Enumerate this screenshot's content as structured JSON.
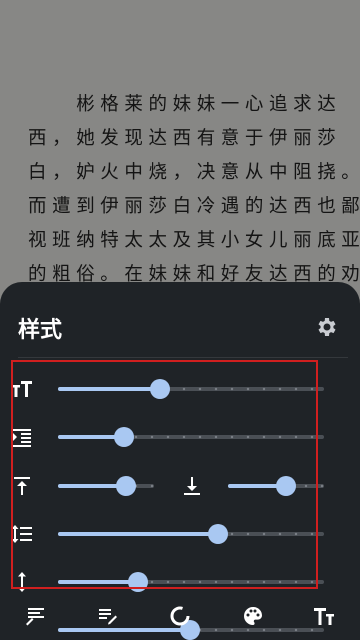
{
  "reader": {
    "lines": [
      "　　彬格莱的妹妹一心追求达",
      "西，她发现达西有意于伊丽莎",
      "白，妒火中烧，决意从中阻挠。",
      "而遭到伊丽莎白冷遇的达西也鄙",
      "视班纳特太太及其小女儿丽底亚",
      "的粗俗。在妹妹和好友达西的劝"
    ]
  },
  "style_panel": {
    "title": "样式",
    "sliders": [
      {
        "icon": "text-size-icon",
        "fraction": 0.38
      },
      {
        "icon": "indent-icon",
        "fraction": 0.24
      },
      {
        "icon": "paragraph-top-spacing-icon",
        "fraction": 0.7
      },
      {
        "icon": "paragraph-bottom-spacing-icon",
        "fraction": 0.62
      },
      {
        "icon": "line-spacing-icon",
        "fraction": 0.6
      },
      {
        "icon": "letter-spacing-icon",
        "fraction": 0.3
      },
      {
        "icon": "paragraph-spacing-icon",
        "fraction": 0.49
      }
    ],
    "bottom_icons": [
      "list-edit-icon",
      "edit-icon",
      "progress-circle-icon",
      "palette-icon",
      "font-icon"
    ]
  },
  "colors": {
    "page_background": "#878785",
    "text": "#141414",
    "panel_background": "#1f2327",
    "accent": "#a9c8f2",
    "highlight_border": "#d01f1f"
  }
}
